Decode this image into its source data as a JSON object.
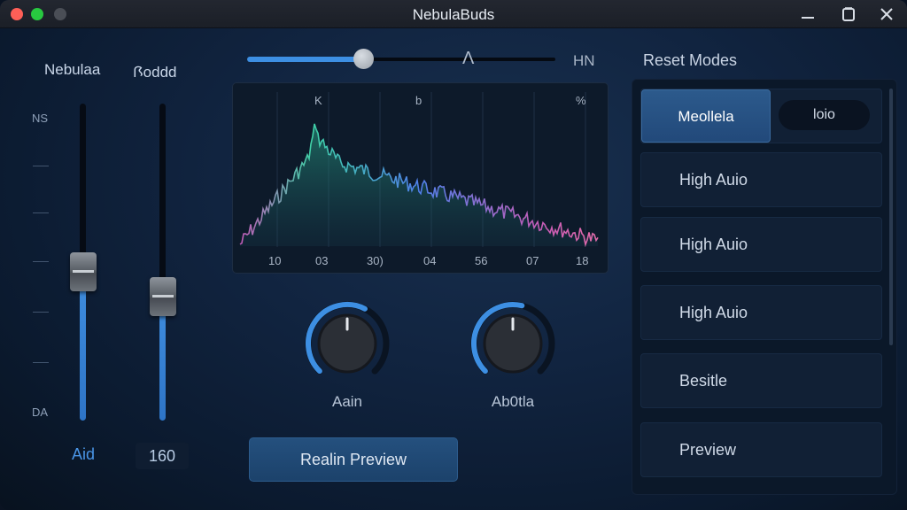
{
  "app": {
    "title": "NebulaBuds"
  },
  "sliders": {
    "left": {
      "label": "Nebulaa",
      "value_text": "Aid",
      "fill_fraction": 0.47
    },
    "right": {
      "label": "Ꟗoddd",
      "value_text": "160",
      "fill_fraction": 0.39
    },
    "scale_top": "NS",
    "scale_bottom": "DA"
  },
  "top_slider": {
    "marker": "Λ",
    "end_label": "HN",
    "level_fraction": 0.38
  },
  "graph": {
    "top_labels": [
      "K",
      "b",
      "%"
    ],
    "x_labels": [
      "10",
      "03",
      "30)",
      "04",
      "56",
      "07",
      "18"
    ]
  },
  "knobs": [
    {
      "label": "Aain",
      "level_fraction": 0.6
    },
    {
      "label": "Ab0tla",
      "level_fraction": 0.55
    }
  ],
  "preview_button": {
    "label": "Realin Preview"
  },
  "modes_panel": {
    "title": "Reset Modes",
    "active_item": "Meollela",
    "pill": "loio",
    "items": [
      "High Auio",
      "High Auio",
      "High Auio",
      "Besitle",
      "Preview"
    ]
  },
  "colors": {
    "accent": "#3d8fe3",
    "background": "#112440",
    "spectrum_green": "#3fd0a6",
    "spectrum_blue": "#4f7fe8",
    "spectrum_pink": "#d25cb5"
  },
  "icons": [
    "minimize-icon",
    "maximize-icon",
    "close-icon"
  ]
}
